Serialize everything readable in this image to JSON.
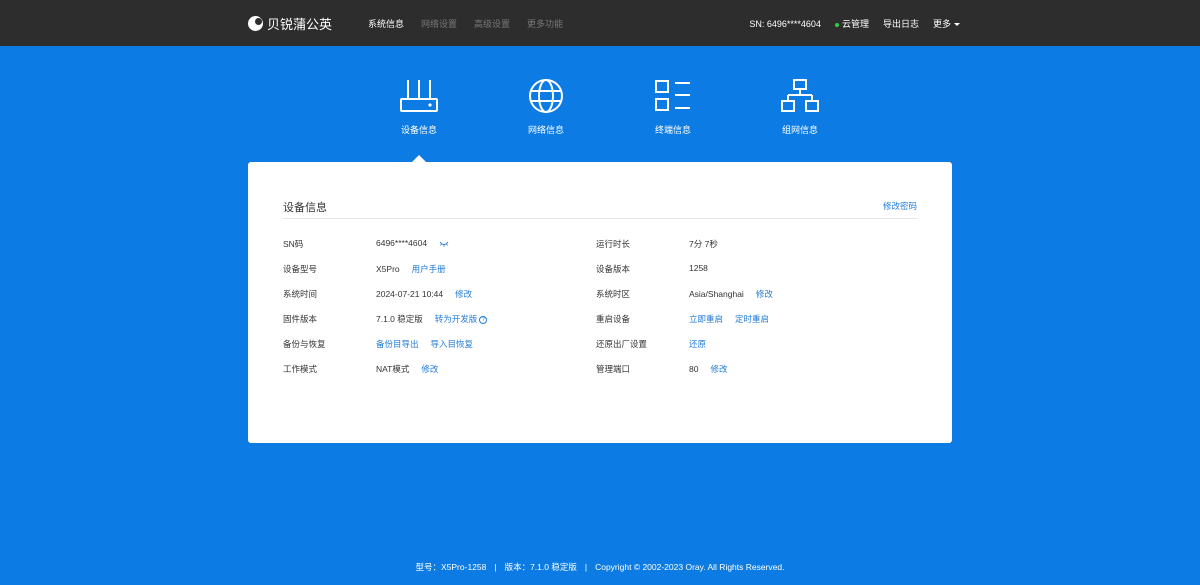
{
  "brand": {
    "name": "贝锐蒲公英"
  },
  "nav": [
    {
      "label": "系统信息",
      "active": true
    },
    {
      "label": "网络设置",
      "active": false
    },
    {
      "label": "高级设置",
      "active": false
    },
    {
      "label": "更多功能",
      "active": false
    }
  ],
  "header_right": {
    "sn": "SN: 6496****4604",
    "cloud": "云管理",
    "export_log": "导出日志",
    "more": "更多"
  },
  "tabs": [
    {
      "label": "设备信息",
      "icon": "router-icon"
    },
    {
      "label": "网络信息",
      "icon": "globe-icon"
    },
    {
      "label": "终端信息",
      "icon": "list-icon"
    },
    {
      "label": "组网信息",
      "icon": "network-icon"
    }
  ],
  "card": {
    "title": "设备信息",
    "action": "修改密码",
    "left": [
      {
        "label": "SN码",
        "value": "6496****4604",
        "links": []
      },
      {
        "label": "设备型号",
        "value": "X5Pro",
        "links": [
          "用户手册"
        ]
      },
      {
        "label": "系统时间",
        "value": "2024-07-21 10:44",
        "links": [
          "修改"
        ]
      },
      {
        "label": "固件版本",
        "value": "7.1.0 稳定版",
        "links": [
          "转为开发版"
        ]
      },
      {
        "label": "备份与恢复",
        "value": "",
        "links": [
          "备份目导出",
          "导入目恢复"
        ]
      },
      {
        "label": "工作模式",
        "value": "NAT模式",
        "links": [
          "修改"
        ]
      }
    ],
    "right": [
      {
        "label": "运行时长",
        "value": "7分 7秒",
        "links": []
      },
      {
        "label": "设备版本",
        "value": "1258",
        "links": []
      },
      {
        "label": "系统时区",
        "value": "Asia/Shanghai",
        "links": [
          "修改"
        ]
      },
      {
        "label": "重启设备",
        "value": "",
        "links": [
          "立即重启",
          "定时重启"
        ]
      },
      {
        "label": "还原出厂设置",
        "value": "",
        "links": [
          "还原"
        ]
      },
      {
        "label": "管理端口",
        "value": "80",
        "links": [
          "修改"
        ]
      }
    ]
  },
  "footer": {
    "model": "型号：X5Pro-1258",
    "version": "版本：7.1.0 稳定版",
    "copyright": "Copyright © 2002-2023 Oray. All Rights Reserved."
  }
}
